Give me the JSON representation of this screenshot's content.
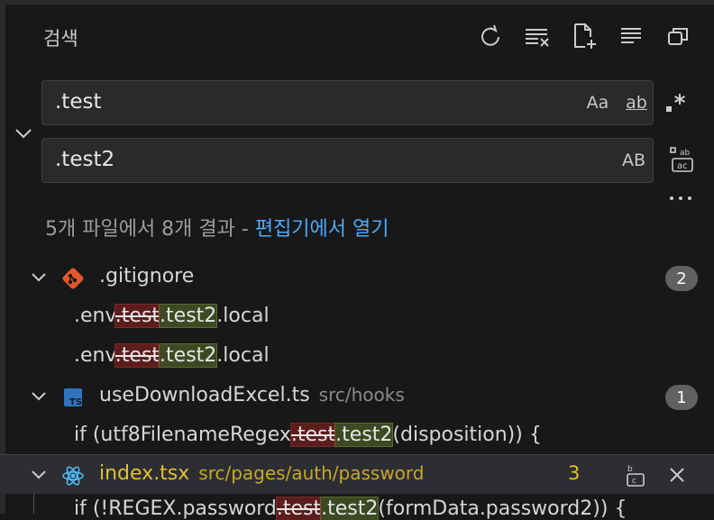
{
  "header": {
    "title": "검색"
  },
  "toolbar": {
    "refresh": "refresh-icon",
    "clear": "clear-results-icon",
    "new_editor": "new-search-editor-icon",
    "collapse": "collapse-all-icon",
    "view": "view-as-tree-icon"
  },
  "search": {
    "value": ".test",
    "options": {
      "match_case": "Aa",
      "whole_word": "ab",
      "regex": ".*"
    }
  },
  "replace": {
    "value": ".test2",
    "preserve_case": "AB"
  },
  "summary": {
    "text": "5개 파일에서 8개 결과 - ",
    "link": "편집기에서 열기"
  },
  "results": [
    {
      "file": ".gitignore",
      "path": "",
      "count": "2",
      "matches": [
        {
          "before": ".env",
          "old": ".test",
          "new": ".test2",
          "after": ".local"
        },
        {
          "before": ".env",
          "old": ".test",
          "new": ".test2",
          "after": ".local"
        }
      ]
    },
    {
      "file": "useDownloadExcel.ts",
      "path": "src/hooks",
      "count": "1",
      "matches": [
        {
          "before": "if (utf8FilenameRegex",
          "old": ".test",
          "new": ".test2",
          "after": "(disposition)) {"
        }
      ]
    },
    {
      "file": "index.tsx",
      "path": "src/pages/auth/password",
      "count": "3",
      "matches": [
        {
          "before": "if (!REGEX.password",
          "old": ".test",
          "new": ".test2",
          "after": "(formData.password2)) {"
        }
      ]
    }
  ],
  "colors": {
    "background": "#181818",
    "link": "#4daafc",
    "active_file": "#e2c12e",
    "deleted_bg": "#5c1d1d",
    "inserted_bg": "#3b4a22",
    "badge_bg": "#616161"
  }
}
